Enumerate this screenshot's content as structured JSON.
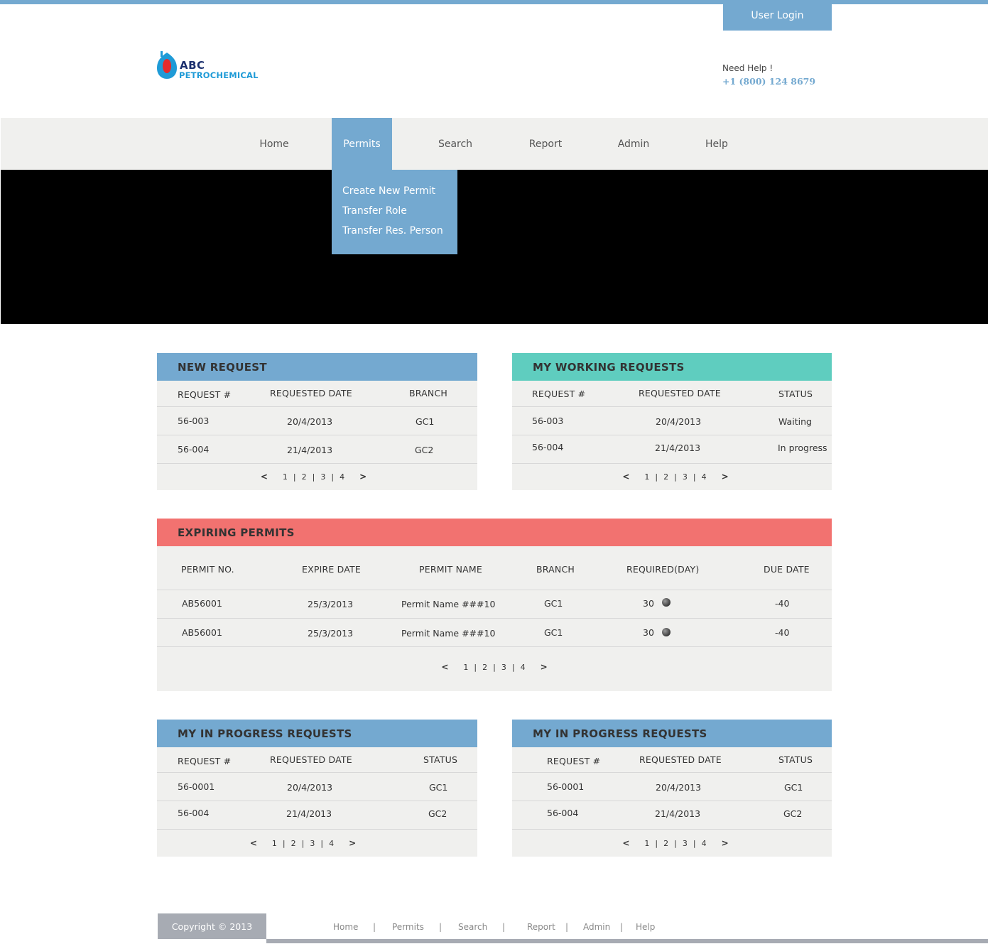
{
  "header": {
    "login_label": "User Login",
    "logo_text_top": "ABC",
    "logo_text_bottom": "PETROCHEMICAL",
    "help_label": "Need Help !",
    "help_phone": "+1 (800) 124 8679"
  },
  "nav": {
    "items": [
      {
        "label": "Home"
      },
      {
        "label": "Permits"
      },
      {
        "label": "Search"
      },
      {
        "label": "Report"
      },
      {
        "label": "Admin"
      },
      {
        "label": "Help"
      }
    ],
    "active": "Permits"
  },
  "dropdown": {
    "items": [
      {
        "label": "Create New Permit"
      },
      {
        "label": "Transfer Role"
      },
      {
        "label": "Transfer Res. Person"
      }
    ]
  },
  "pager": {
    "prev": "<",
    "next": ">",
    "pages": [
      "1",
      "2",
      "3",
      "4"
    ],
    "sep": "|"
  },
  "new_request": {
    "title": "NEW REQUEST",
    "columns": [
      "REQUEST #",
      "REQUESTED DATE",
      "BRANCH"
    ],
    "rows": [
      [
        "56-003",
        "20/4/2013",
        "GC1"
      ],
      [
        "56-004",
        "21/4/2013",
        "GC2"
      ]
    ]
  },
  "working_requests": {
    "title": "MY WORKING REQUESTS",
    "columns": [
      "REQUEST #",
      "REQUESTED DATE",
      "STATUS"
    ],
    "rows": [
      [
        "56-003",
        "20/4/2013",
        "Waiting"
      ],
      [
        "56-004",
        "21/4/2013",
        "In progress"
      ]
    ]
  },
  "expiring_permits": {
    "title": "EXPIRING PERMITS",
    "columns": [
      "PERMIT NO.",
      "EXPIRE DATE",
      "PERMIT NAME",
      "BRANCH",
      "REQUIRED(DAY)",
      "DUE DATE"
    ],
    "rows": [
      [
        "AB56001",
        "25/3/2013",
        "Permit Name ###10",
        "GC1",
        "30",
        "-40"
      ],
      [
        "AB56001",
        "25/3/2013",
        "Permit Name ###10",
        "GC1",
        "30",
        "-40"
      ]
    ]
  },
  "in_progress_left": {
    "title": "MY IN PROGRESS REQUESTS",
    "columns": [
      "REQUEST #",
      "REQUESTED DATE",
      "STATUS"
    ],
    "rows": [
      [
        "56-0001",
        "20/4/2013",
        "GC1"
      ],
      [
        "56-004",
        "21/4/2013",
        "GC2"
      ]
    ]
  },
  "in_progress_right": {
    "title": "MY IN PROGRESS REQUESTS",
    "columns": [
      "REQUEST #",
      "REQUESTED DATE",
      "STATUS"
    ],
    "rows": [
      [
        "56-0001",
        "20/4/2013",
        "GC1"
      ],
      [
        "56-004",
        "21/4/2013",
        "GC2"
      ]
    ]
  },
  "footer": {
    "copyright": "Copyright © 2013",
    "links": [
      {
        "label": "Home"
      },
      {
        "label": "Permits"
      },
      {
        "label": "Search"
      },
      {
        "label": "Report"
      },
      {
        "label": "Admin"
      },
      {
        "label": "Help"
      }
    ],
    "sep": "|"
  },
  "colors": {
    "accent_blue": "#74a9d0",
    "teal": "#5fcdbf",
    "red": "#f27270",
    "panel_bg": "#f0f0ee"
  }
}
